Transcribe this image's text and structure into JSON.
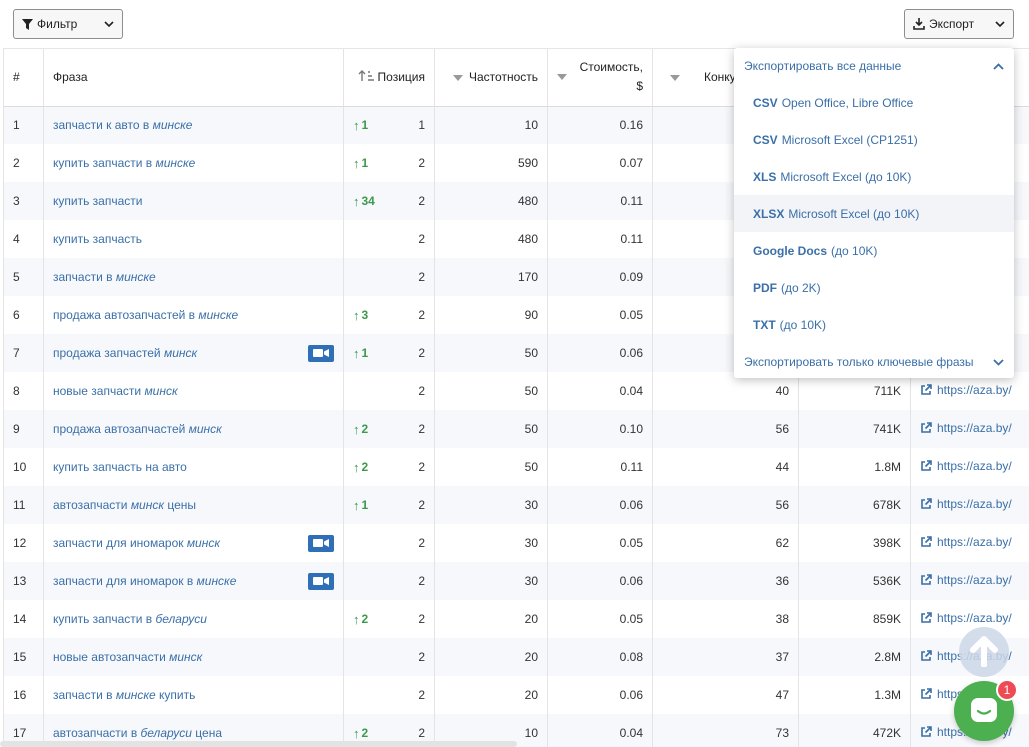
{
  "toolbar": {
    "filter_label": "Фильтр",
    "export_label": "Экспорт"
  },
  "table": {
    "headers": {
      "num": "#",
      "phrase": "Фраза",
      "position": "Позиция",
      "frequency": "Частотность",
      "cost": "Стоимость, $",
      "competition": "Конкуренция",
      "results": "",
      "url": ""
    },
    "rows": [
      {
        "n": "1",
        "parts": [
          {
            "t": "запчасти к авто в ",
            "em": false
          },
          {
            "t": "минске",
            "em": true
          }
        ],
        "video": false,
        "delta": "1",
        "pos": "1",
        "freq": "10",
        "cost": "0.16",
        "comp": "",
        "res": "",
        "url": ""
      },
      {
        "n": "2",
        "parts": [
          {
            "t": "купить запчасти в ",
            "em": false
          },
          {
            "t": "минске",
            "em": true
          }
        ],
        "video": false,
        "delta": "1",
        "pos": "2",
        "freq": "590",
        "cost": "0.07",
        "comp": "",
        "res": "",
        "url": ""
      },
      {
        "n": "3",
        "parts": [
          {
            "t": "купить запчасти",
            "em": false
          }
        ],
        "video": false,
        "delta": "34",
        "pos": "2",
        "freq": "480",
        "cost": "0.11",
        "comp": "",
        "res": "",
        "url": ""
      },
      {
        "n": "4",
        "parts": [
          {
            "t": "купить запчасть",
            "em": false
          }
        ],
        "video": false,
        "delta": "",
        "pos": "2",
        "freq": "480",
        "cost": "0.11",
        "comp": "",
        "res": "",
        "url": ""
      },
      {
        "n": "5",
        "parts": [
          {
            "t": "запчасти в ",
            "em": false
          },
          {
            "t": "минске",
            "em": true
          }
        ],
        "video": false,
        "delta": "",
        "pos": "2",
        "freq": "170",
        "cost": "0.09",
        "comp": "",
        "res": "",
        "url": ""
      },
      {
        "n": "6",
        "parts": [
          {
            "t": "продажа автозапчастей в ",
            "em": false
          },
          {
            "t": "минске",
            "em": true
          }
        ],
        "video": false,
        "delta": "3",
        "pos": "2",
        "freq": "90",
        "cost": "0.05",
        "comp": "",
        "res": "",
        "url": ""
      },
      {
        "n": "7",
        "parts": [
          {
            "t": "продажа запчастей ",
            "em": false
          },
          {
            "t": "минск",
            "em": true
          }
        ],
        "video": true,
        "delta": "1",
        "pos": "2",
        "freq": "50",
        "cost": "0.06",
        "comp": "",
        "res": "",
        "url": ""
      },
      {
        "n": "8",
        "parts": [
          {
            "t": "новые запчасти ",
            "em": false
          },
          {
            "t": "минск",
            "em": true
          }
        ],
        "video": false,
        "delta": "",
        "pos": "2",
        "freq": "50",
        "cost": "0.04",
        "comp": "40",
        "res": "711K",
        "url": "https://aza.by/"
      },
      {
        "n": "9",
        "parts": [
          {
            "t": "продажа автозапчастей ",
            "em": false
          },
          {
            "t": "минск",
            "em": true
          }
        ],
        "video": false,
        "delta": "2",
        "pos": "2",
        "freq": "50",
        "cost": "0.10",
        "comp": "56",
        "res": "741K",
        "url": "https://aza.by/"
      },
      {
        "n": "10",
        "parts": [
          {
            "t": "купить запчасть на авто",
            "em": false
          }
        ],
        "video": false,
        "delta": "2",
        "pos": "2",
        "freq": "50",
        "cost": "0.11",
        "comp": "44",
        "res": "1.8M",
        "url": "https://aza.by/"
      },
      {
        "n": "11",
        "parts": [
          {
            "t": "автозапчасти ",
            "em": false
          },
          {
            "t": "минск",
            "em": true
          },
          {
            "t": " цены",
            "em": false
          }
        ],
        "video": false,
        "delta": "1",
        "pos": "2",
        "freq": "30",
        "cost": "0.06",
        "comp": "56",
        "res": "678K",
        "url": "https://aza.by/"
      },
      {
        "n": "12",
        "parts": [
          {
            "t": "запчасти для иномарок ",
            "em": false
          },
          {
            "t": "минск",
            "em": true
          }
        ],
        "video": true,
        "delta": "",
        "pos": "2",
        "freq": "30",
        "cost": "0.05",
        "comp": "62",
        "res": "398K",
        "url": "https://aza.by/"
      },
      {
        "n": "13",
        "parts": [
          {
            "t": "запчасти для иномарок в ",
            "em": false
          },
          {
            "t": "минске",
            "em": true
          }
        ],
        "video": true,
        "delta": "",
        "pos": "2",
        "freq": "30",
        "cost": "0.06",
        "comp": "36",
        "res": "536K",
        "url": "https://aza.by/"
      },
      {
        "n": "14",
        "parts": [
          {
            "t": "купить запчасти в ",
            "em": false
          },
          {
            "t": "беларуси",
            "em": true
          }
        ],
        "video": false,
        "delta": "2",
        "pos": "2",
        "freq": "20",
        "cost": "0.05",
        "comp": "38",
        "res": "859K",
        "url": "https://aza.by/"
      },
      {
        "n": "15",
        "parts": [
          {
            "t": "новые автозапчасти ",
            "em": false
          },
          {
            "t": "минск",
            "em": true
          }
        ],
        "video": false,
        "delta": "",
        "pos": "2",
        "freq": "20",
        "cost": "0.08",
        "comp": "37",
        "res": "2.8M",
        "url": "https://aza.by/"
      },
      {
        "n": "16",
        "parts": [
          {
            "t": "запчасти в ",
            "em": false
          },
          {
            "t": "минске",
            "em": true
          },
          {
            "t": " купить",
            "em": false
          }
        ],
        "video": false,
        "delta": "",
        "pos": "2",
        "freq": "20",
        "cost": "0.06",
        "comp": "47",
        "res": "1.3M",
        "url": "https://aza.by/"
      },
      {
        "n": "17",
        "parts": [
          {
            "t": "автозапчасти в ",
            "em": false
          },
          {
            "t": "беларуси",
            "em": true
          },
          {
            "t": " цена",
            "em": false
          }
        ],
        "video": false,
        "delta": "2",
        "pos": "2",
        "freq": "10",
        "cost": "0.04",
        "comp": "73",
        "res": "472K",
        "url": "https://aza.by/"
      }
    ]
  },
  "export_menu": {
    "all_data": "Экспортировать все данные",
    "items": [
      {
        "bold": "CSV",
        "rest": "Open Office, Libre Office"
      },
      {
        "bold": "CSV",
        "rest": "Microsoft Excel (CP1251)"
      },
      {
        "bold": "XLS",
        "rest": "Microsoft Excel (до 10K)"
      },
      {
        "bold": "XLSX",
        "rest": "Microsoft Excel (до 10K)"
      },
      {
        "bold": "Google Docs",
        "rest": "(до 10K)"
      },
      {
        "bold": "PDF",
        "rest": "(до 2K)"
      },
      {
        "bold": "TXT",
        "rest": "(до 10K)"
      }
    ],
    "keywords_only": "Экспортировать только ключевые фразы"
  },
  "chat": {
    "badge_count": "1"
  },
  "colors": {
    "link": "#3a6fa8",
    "up": "#3b9a49",
    "chat": "#4caf50",
    "badge": "#ef4b55",
    "video": "#2f6fb7"
  }
}
